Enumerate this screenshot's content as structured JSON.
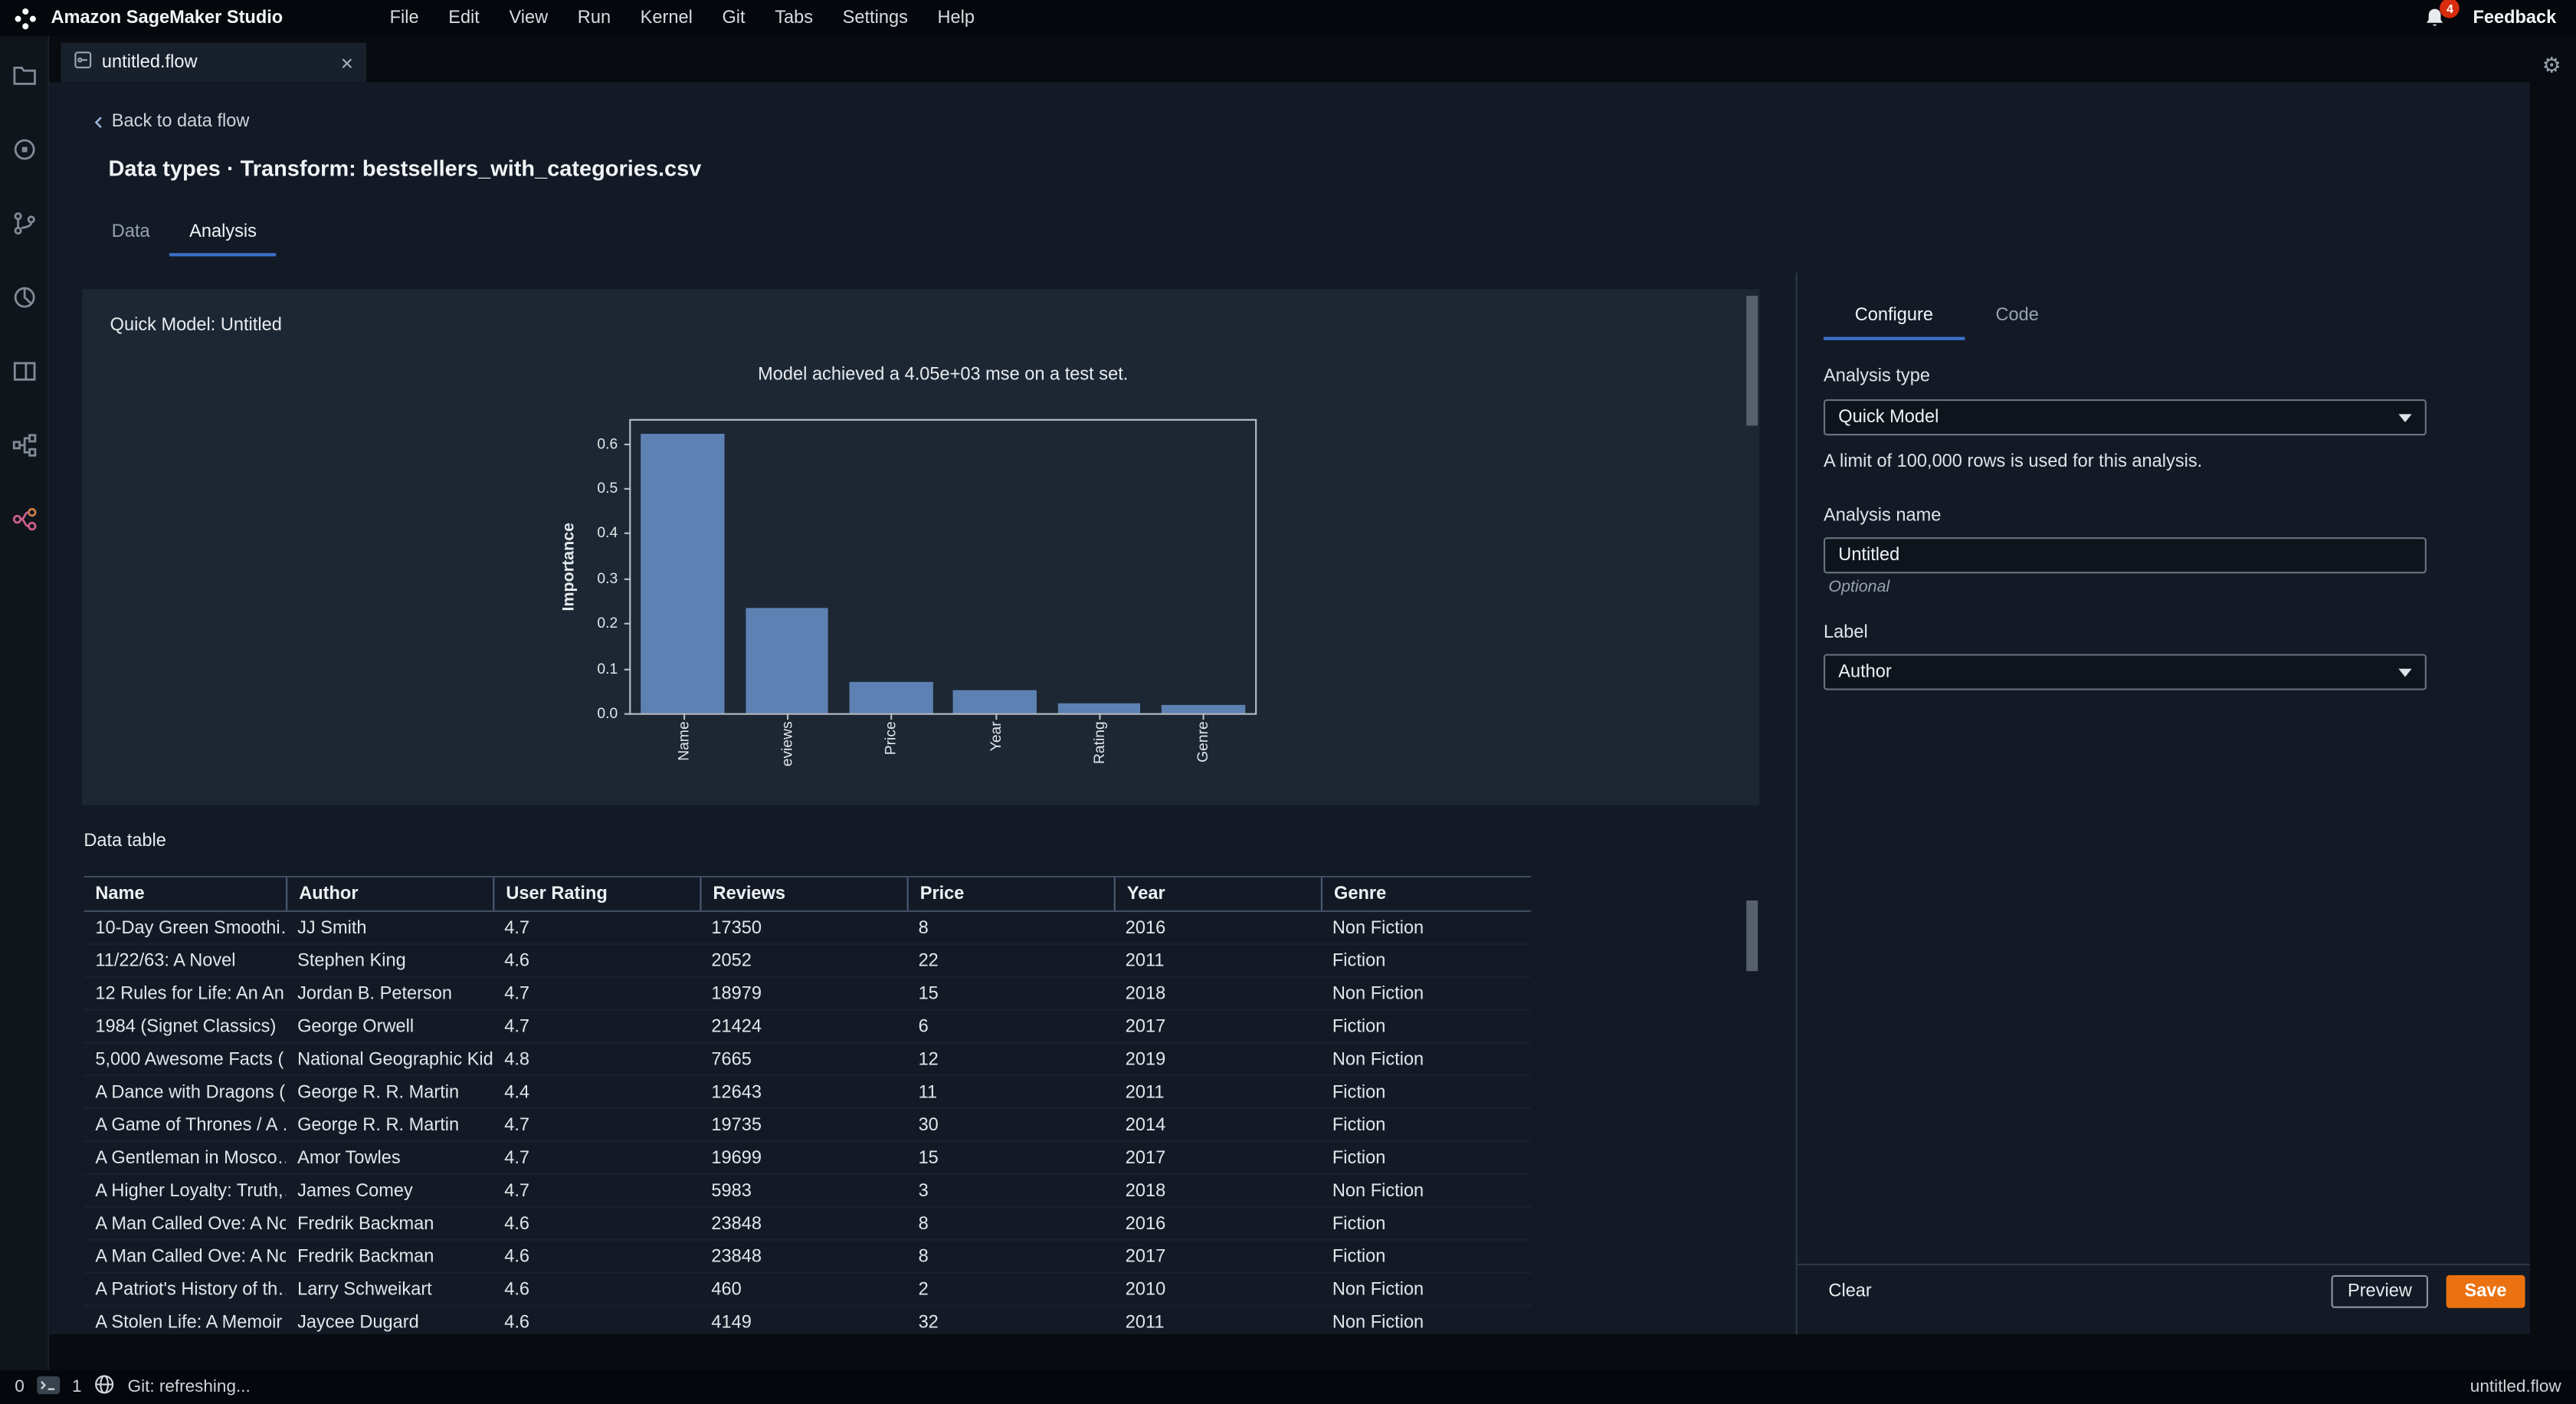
{
  "menu_bar": {
    "app_title": "Amazon SageMaker Studio",
    "items": [
      "File",
      "Edit",
      "View",
      "Run",
      "Kernel",
      "Git",
      "Tabs",
      "Settings",
      "Help"
    ],
    "notification_count": "4",
    "feedback_label": "Feedback"
  },
  "tab_bar": {
    "tab_title": "untitled.flow"
  },
  "sidebar": {
    "icons": [
      "folder-icon",
      "running-circle-icon",
      "git-branch-icon",
      "palette-icon",
      "open-tabs-icon",
      "pipeline-icon",
      "data-wrangler-flow-icon"
    ]
  },
  "page": {
    "back_link": "Back to data flow",
    "title": "Data types · Transform: bestsellers_with_categories.csv",
    "tabs": [
      {
        "label": "Data",
        "active": false
      },
      {
        "label": "Analysis",
        "active": true
      }
    ]
  },
  "quick_model": {
    "title": "Quick Model: Untitled"
  },
  "chart_data": {
    "type": "bar",
    "title": "Model achieved a 4.05e+03 mse on a test set.",
    "categories": [
      "Name",
      "eviews",
      "Price",
      "Year",
      "Rating",
      "Genre"
    ],
    "values": [
      0.62,
      0.235,
      0.07,
      0.05,
      0.022,
      0.02
    ],
    "xlabel": "",
    "ylabel": "Importance",
    "ylim": [
      0,
      0.65
    ],
    "yticks": [
      0.0,
      0.1,
      0.2,
      0.3,
      0.4,
      0.5,
      0.6
    ],
    "bar_color": "#5d81b2",
    "grid": false,
    "legend": false
  },
  "table": {
    "section_title": "Data table",
    "headers": [
      "Name",
      "Author",
      "User Rating",
      "Reviews",
      "Price",
      "Year",
      "Genre"
    ],
    "rows": [
      [
        "10-Day Green Smoothi…",
        "JJ Smith",
        "4.7",
        "17350",
        "8",
        "2016",
        "Non Fiction"
      ],
      [
        "11/22/63: A Novel",
        "Stephen King",
        "4.6",
        "2052",
        "22",
        "2011",
        "Fiction"
      ],
      [
        "12 Rules for Life: An An…",
        "Jordan B. Peterson",
        "4.7",
        "18979",
        "15",
        "2018",
        "Non Fiction"
      ],
      [
        "1984 (Signet Classics)",
        "George Orwell",
        "4.7",
        "21424",
        "6",
        "2017",
        "Fiction"
      ],
      [
        "5,000 Awesome Facts (…",
        "National Geographic Kids",
        "4.8",
        "7665",
        "12",
        "2019",
        "Non Fiction"
      ],
      [
        "A Dance with Dragons (…",
        "George R. R. Martin",
        "4.4",
        "12643",
        "11",
        "2011",
        "Fiction"
      ],
      [
        "A Game of Thrones / A …",
        "George R. R. Martin",
        "4.7",
        "19735",
        "30",
        "2014",
        "Fiction"
      ],
      [
        "A Gentleman in Mosco…",
        "Amor Towles",
        "4.7",
        "19699",
        "15",
        "2017",
        "Fiction"
      ],
      [
        "A Higher Loyalty: Truth,…",
        "James Comey",
        "4.7",
        "5983",
        "3",
        "2018",
        "Non Fiction"
      ],
      [
        "A Man Called Ove: A No…",
        "Fredrik Backman",
        "4.6",
        "23848",
        "8",
        "2016",
        "Fiction"
      ],
      [
        "A Man Called Ove: A No…",
        "Fredrik Backman",
        "4.6",
        "23848",
        "8",
        "2017",
        "Fiction"
      ],
      [
        "A Patriot's History of th…",
        "Larry Schweikart",
        "4.6",
        "460",
        "2",
        "2010",
        "Non Fiction"
      ],
      [
        "A Stolen Life: A Memoir",
        "Jaycee Dugard",
        "4.6",
        "4149",
        "32",
        "2011",
        "Non Fiction"
      ]
    ]
  },
  "config_panel": {
    "tabs": [
      {
        "label": "Configure",
        "active": true
      },
      {
        "label": "Code",
        "active": false
      }
    ],
    "analysis_type_label": "Analysis type",
    "analysis_type_value": "Quick Model",
    "limit_note": "A limit of 100,000 rows is used for this analysis.",
    "analysis_name_label": "Analysis name",
    "analysis_name_value": "Untitled",
    "optional_label": "Optional",
    "label_label": "Label",
    "label_value": "Author",
    "clear_label": "Clear",
    "preview_label": "Preview",
    "save_label": "Save"
  },
  "status_bar": {
    "terminal_count": "0",
    "kernel_count": "1",
    "git_status": "Git: refreshing...",
    "active_file": "untitled.flow"
  },
  "colors": {
    "accent_blue": "#3a6fc8",
    "save_orange": "#ec7211",
    "badge_red": "#d72c0d",
    "bar_fill": "#5d81b2"
  }
}
